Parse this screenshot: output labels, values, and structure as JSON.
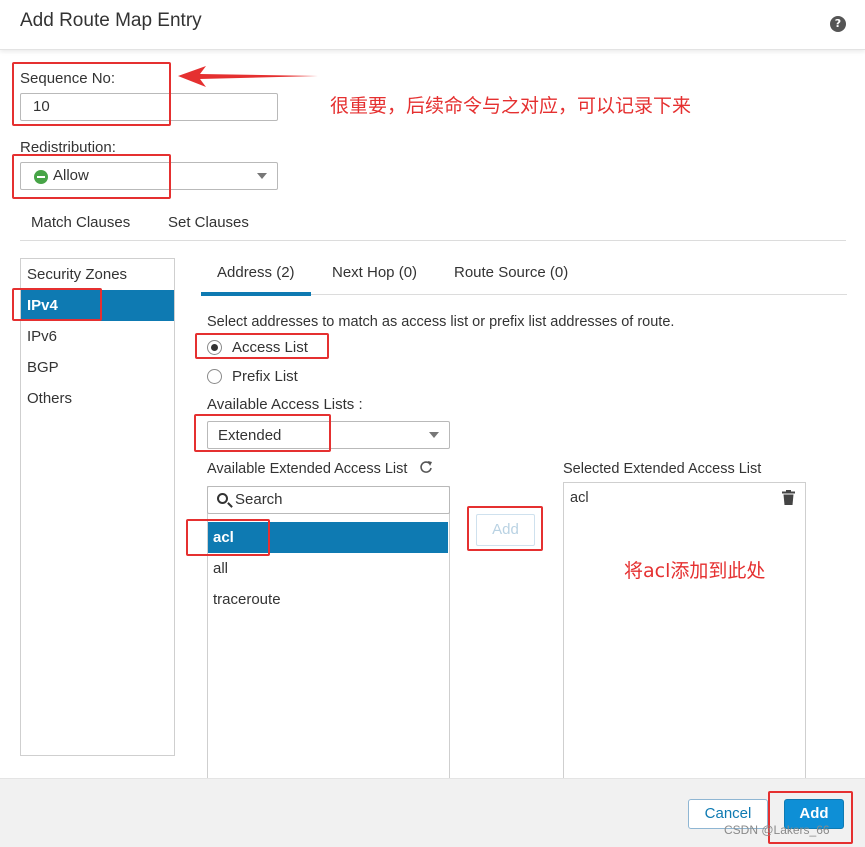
{
  "dialog": {
    "title": "Add Route Map Entry",
    "help_icon": "?"
  },
  "form": {
    "sequence_label": "Sequence No:",
    "sequence_value": "10",
    "redistribution_label": "Redistribution:",
    "redistribution_value": "Allow",
    "redistribution_icon": "allow-circle-icon"
  },
  "clause_tabs": [
    "Match Clauses",
    "Set Clauses"
  ],
  "sidebar": {
    "items": [
      {
        "label": "Security Zones"
      },
      {
        "label": "IPv4",
        "selected": true
      },
      {
        "label": "IPv6"
      },
      {
        "label": "BGP"
      },
      {
        "label": "Others"
      }
    ]
  },
  "inner_tabs": [
    {
      "label": "Address (2)",
      "active": true
    },
    {
      "label": "Next Hop (0)"
    },
    {
      "label": "Route Source (0)"
    }
  ],
  "address": {
    "instruction": "Select addresses to match as access list or prefix list addresses of route.",
    "radio_access": "Access List",
    "radio_prefix": "Prefix List",
    "radio_selected": "Access List",
    "available_label": "Available Access Lists :",
    "available_value": "Extended",
    "available_ext_label": "Available Extended Access List",
    "refresh_icon": "refresh-icon",
    "search_placeholder": "Search",
    "available_items": [
      {
        "label": "acl",
        "selected": true
      },
      {
        "label": "all"
      },
      {
        "label": "traceroute"
      }
    ],
    "add_button": "Add",
    "selected_label": "Selected Extended Access List",
    "selected_items": [
      {
        "label": "acl"
      }
    ]
  },
  "footer": {
    "cancel": "Cancel",
    "add": "Add"
  },
  "annotations": {
    "note_sequence": "很重要，后续命令与之对应，可以记录下来",
    "note_acl": "将acl添加到此处",
    "color": "#e53030"
  },
  "watermark": "CSDN @Lakers_66",
  "colors": {
    "accent": "#0e7ab2",
    "add_button": "#0e8fd6",
    "allow_green": "#47a447"
  }
}
